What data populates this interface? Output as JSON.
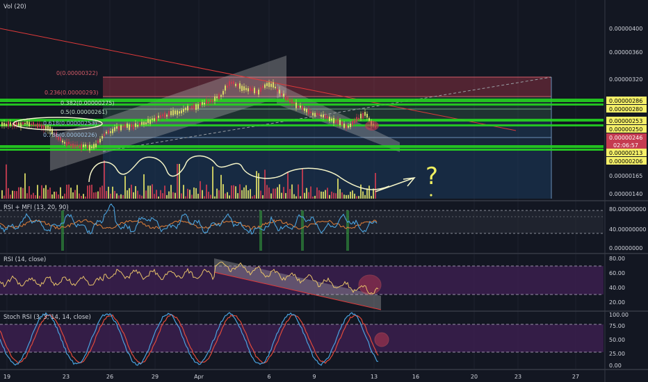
{
  "colors": {
    "background": "#131722",
    "grid": "#1e222d",
    "up": "#d9d966",
    "down": "#c53b50",
    "green_band": "#25d420",
    "rsi_purple": "#3b1f4e",
    "mfi": "#e3813a",
    "rsi_mfi_rsi": "#4aa3df",
    "stoch_k": "#4aa3df",
    "stoch_d": "#e24a3b",
    "fib_pink": "#d45b68",
    "trendline": "#e03a3a"
  },
  "panes": {
    "main": {
      "title": "Vol (20)"
    },
    "rsi_mfi": {
      "title": "RSI + MFI (13, 20, 90)"
    },
    "rsi": {
      "title": "RSI (14, close)"
    },
    "stoch": {
      "title": "Stoch RSI (3, 3, 14, 14, close)"
    }
  },
  "price_axis": {
    "ticks": [
      "0.00000400",
      "0.00000360",
      "0.00000320",
      "0.00000165",
      "0.00000140"
    ],
    "badges": [
      {
        "label": "0.00000286",
        "kind": "yellow"
      },
      {
        "label": "0.00000280",
        "kind": "yellow"
      },
      {
        "label": "0.00000253",
        "kind": "yellow"
      },
      {
        "label": "0.00000250",
        "kind": "yellow"
      },
      {
        "label": "0.00000246",
        "kind": "red"
      },
      {
        "label": "02:06:57",
        "kind": "timer"
      },
      {
        "label": "0.00000213",
        "kind": "yellow"
      },
      {
        "label": "0.00000206",
        "kind": "yellow"
      }
    ]
  },
  "fib_labels": [
    "0(0.00000322)",
    "0.236(0.00000293)",
    "0.382(0.00000275)",
    "0.5(0.00000261)",
    "0.618(0.00000253)",
    "0.786(0.00000226)"
  ],
  "annotation": {
    "question": "?"
  },
  "rsi_mfi_axis": {
    "ticks": [
      "80.00000000",
      "40.00000000",
      "0.00000000"
    ]
  },
  "rsi_axis": {
    "ticks": [
      "80.00",
      "60.00",
      "40.00",
      "20.00"
    ]
  },
  "stoch_axis": {
    "ticks": [
      "100.00",
      "75.00",
      "50.00",
      "25.00",
      "0.00"
    ]
  },
  "time_axis": {
    "labels": [
      "19",
      "23",
      "26",
      "29",
      "Apr",
      "6",
      "9",
      "13",
      "16",
      "20",
      "23",
      "27"
    ]
  },
  "chart_data": {
    "type": "candlestick",
    "title": "",
    "price_scale_ticks": [
      4e-06,
      3.6e-06,
      3.2e-06,
      1.65e-06,
      1.4e-06
    ],
    "fib_retracement": [
      {
        "level": 0,
        "price": 3.22e-06
      },
      {
        "level": 0.236,
        "price": 2.93e-06
      },
      {
        "level": 0.382,
        "price": 2.75e-06
      },
      {
        "level": 0.5,
        "price": 2.61e-06
      },
      {
        "level": 0.618,
        "price": 2.53e-06
      },
      {
        "level": 0.786,
        "price": 2.26e-06
      }
    ],
    "last_price": 2.46e-06,
    "bar_countdown": "02:06:57",
    "rsi_mfi_scale": [
      0,
      40,
      80
    ],
    "rsi_scale": [
      20,
      40,
      60,
      80
    ],
    "stoch_rsi_scale": [
      0,
      25,
      50,
      75,
      100
    ],
    "x_labels": [
      "19",
      "23",
      "26",
      "29",
      "Apr",
      "6",
      "9",
      "13",
      "16",
      "20",
      "23",
      "27"
    ]
  }
}
